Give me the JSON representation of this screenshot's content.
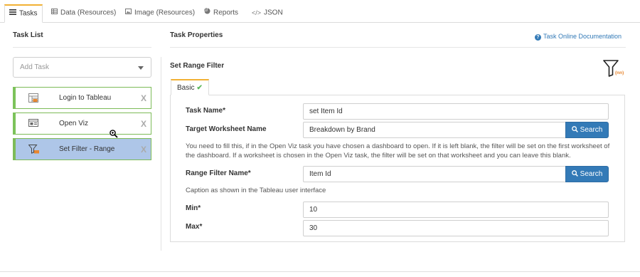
{
  "tabs": [
    {
      "label": "Tasks",
      "icon": "list-icon",
      "active": true
    },
    {
      "label": "Data (Resources)",
      "icon": "table-icon",
      "active": false
    },
    {
      "label": "Image (Resources)",
      "icon": "image-icon",
      "active": false
    },
    {
      "label": "Reports",
      "icon": "pie-chart-icon",
      "active": false
    },
    {
      "label": "JSON",
      "icon": "code-icon",
      "active": false
    }
  ],
  "task_list": {
    "title": "Task List",
    "add_task_placeholder": "Add Task",
    "tasks": [
      {
        "label": "Login to Tableau",
        "icon": "login-icon",
        "active": false
      },
      {
        "label": "Open Viz",
        "icon": "viz-icon",
        "active": false
      },
      {
        "label": "Set Filter - Range",
        "icon": "filter-range-icon",
        "active": true
      }
    ],
    "remove_glyph": "X"
  },
  "properties": {
    "title": "Task Properties",
    "doc_link": "Task Online Documentation",
    "section_title": "Set Range Filter",
    "filter_icon_text": "(nn)",
    "subtab": "Basic"
  },
  "form": {
    "task_name_label": "Task Name*",
    "task_name_value": "set Item Id",
    "target_worksheet_label": "Target Worksheet Name",
    "target_worksheet_value": "Breakdown by Brand",
    "search_label": "Search",
    "worksheet_help": "You need to fill this, if in the Open Viz task you have chosen a dashboard to open. If it is left blank, the filter will be set on the first worksheet of the dashboard. If a worksheet is chosen in the Open Viz task, the filter will be set on that worksheet and you can leave this blank.",
    "range_filter_label": "Range Filter Name*",
    "range_filter_value": "Item Id",
    "range_filter_help": "Caption as shown in the Tableau user interface",
    "min_label": "Min*",
    "min_value": "10",
    "max_label": "Max*",
    "max_value": "30"
  },
  "colors": {
    "accent_tab": "#f2b134",
    "task_border": "#7cc35a",
    "active_task": "#aec6e8",
    "primary_button": "#337ab7"
  }
}
